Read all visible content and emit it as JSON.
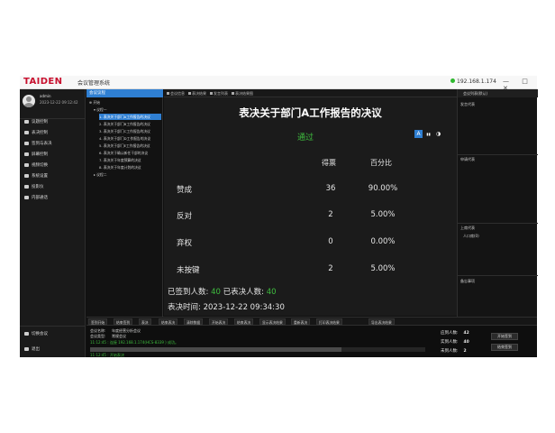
{
  "titlebar": {
    "brand": "TAIDEN",
    "app_title": "会议管理系统",
    "ip": "192.168.1.174",
    "window_controls": "— □ ✕"
  },
  "user": {
    "name": "admin",
    "datetime": "2023-12-22 09:12:42"
  },
  "sidebar": {
    "items": [
      {
        "label": "议题控制",
        "icon": "agenda-icon"
      },
      {
        "label": "表决控制",
        "icon": "vote-icon"
      },
      {
        "label": "签到与表决",
        "icon": "checkin-icon"
      },
      {
        "label": "屏幕控制",
        "icon": "screen-icon"
      },
      {
        "label": "视频切换",
        "icon": "video-icon"
      },
      {
        "label": "系统设置",
        "icon": "settings-icon"
      },
      {
        "label": "投影仪",
        "icon": "projector-icon"
      },
      {
        "label": "内部通话",
        "icon": "intercom-icon"
      }
    ],
    "bottom_items": [
      {
        "label": "切换会议",
        "icon": "switch-icon"
      },
      {
        "label": "退出",
        "icon": "exit-icon"
      }
    ]
  },
  "tree": {
    "header": "会议议程",
    "rows": [
      {
        "label": "⊕ 开始",
        "indent": 0,
        "selected": false
      },
      {
        "label": "▾ 议程一",
        "indent": 1,
        "selected": false
      },
      {
        "label": "1. 表决关于部门A工作报告的决议",
        "indent": 3,
        "selected": true
      },
      {
        "label": "2. 表决关于部门B工作报告的决议",
        "indent": 3,
        "selected": false
      },
      {
        "label": "3. 表决关于部门C工作报告的决议",
        "indent": 3,
        "selected": false
      },
      {
        "label": "4. 表决关于部门D工作报告的决议",
        "indent": 3,
        "selected": false
      },
      {
        "label": "5. 表决关于部门E工作报告的决议",
        "indent": 3,
        "selected": false
      },
      {
        "label": "6. 表决关于确认新任干部的决议",
        "indent": 3,
        "selected": false
      },
      {
        "label": "7. 表决关于年度预算的决议",
        "indent": 3,
        "selected": false
      },
      {
        "label": "8. 表决关于年度计划的决议",
        "indent": 3,
        "selected": false
      },
      {
        "label": "▸ 议程二",
        "indent": 1,
        "selected": false
      }
    ]
  },
  "tabs": [
    "会议信息",
    "表决结果",
    "发言列表",
    "表决结果图"
  ],
  "vote": {
    "title": "表决关于部门A工作报告的决议",
    "status": "通过",
    "header_votes": "得票",
    "header_pct": "百分比",
    "rows": [
      {
        "label": "赞成",
        "count": "36",
        "pct": "90.00%"
      },
      {
        "label": "反对",
        "count": "2",
        "pct": "5.00%"
      },
      {
        "label": "弃权",
        "count": "0",
        "pct": "0.00%"
      },
      {
        "label": "未按键",
        "count": "2",
        "pct": "5.00%"
      }
    ],
    "signed_label": "已签到人数:",
    "signed_value": "40",
    "voted_label": "已表决人数:",
    "voted_value": "40",
    "time_label": "表决时间:",
    "time_value": "2023-12-22 09:34:30",
    "view_buttons": {
      "text_view": "A",
      "bar_view": "▮▮",
      "pie_view": "◑"
    }
  },
  "right_panel": {
    "header": "会议列表(默认)",
    "speaking": "发言代表",
    "request": "申请代表",
    "sections_count": "上席代表",
    "seat_item": "人口席(0)",
    "notice": "备忘事项"
  },
  "bottom_toolbar": [
    "签到开始",
    "结束签到",
    "表决",
    "结束表决",
    "清除数据",
    "开始表决",
    "结束表决",
    "显示表决结果",
    "重新表决",
    "打印表决结果",
    "导出表决结果"
  ],
  "status": {
    "meeting_label": "会议名称:",
    "meeting_value": "年度经营分析会议",
    "type_label": "会议类型:",
    "type_value": "常规会议",
    "log_line1": "11:12:45 : 连接 192.168.1.174(HCS-8339 ) 成功。",
    "log_line2": "11:12:45 : 开始表决",
    "progress": 0.75,
    "present_label": "应到人数:",
    "present_value": "42",
    "signed_label": "实到人数:",
    "signed_value": "40",
    "absent_label": "未到人数:",
    "absent_value": "2",
    "btn_signin": "开始签到",
    "btn_stop": "结束签到"
  }
}
